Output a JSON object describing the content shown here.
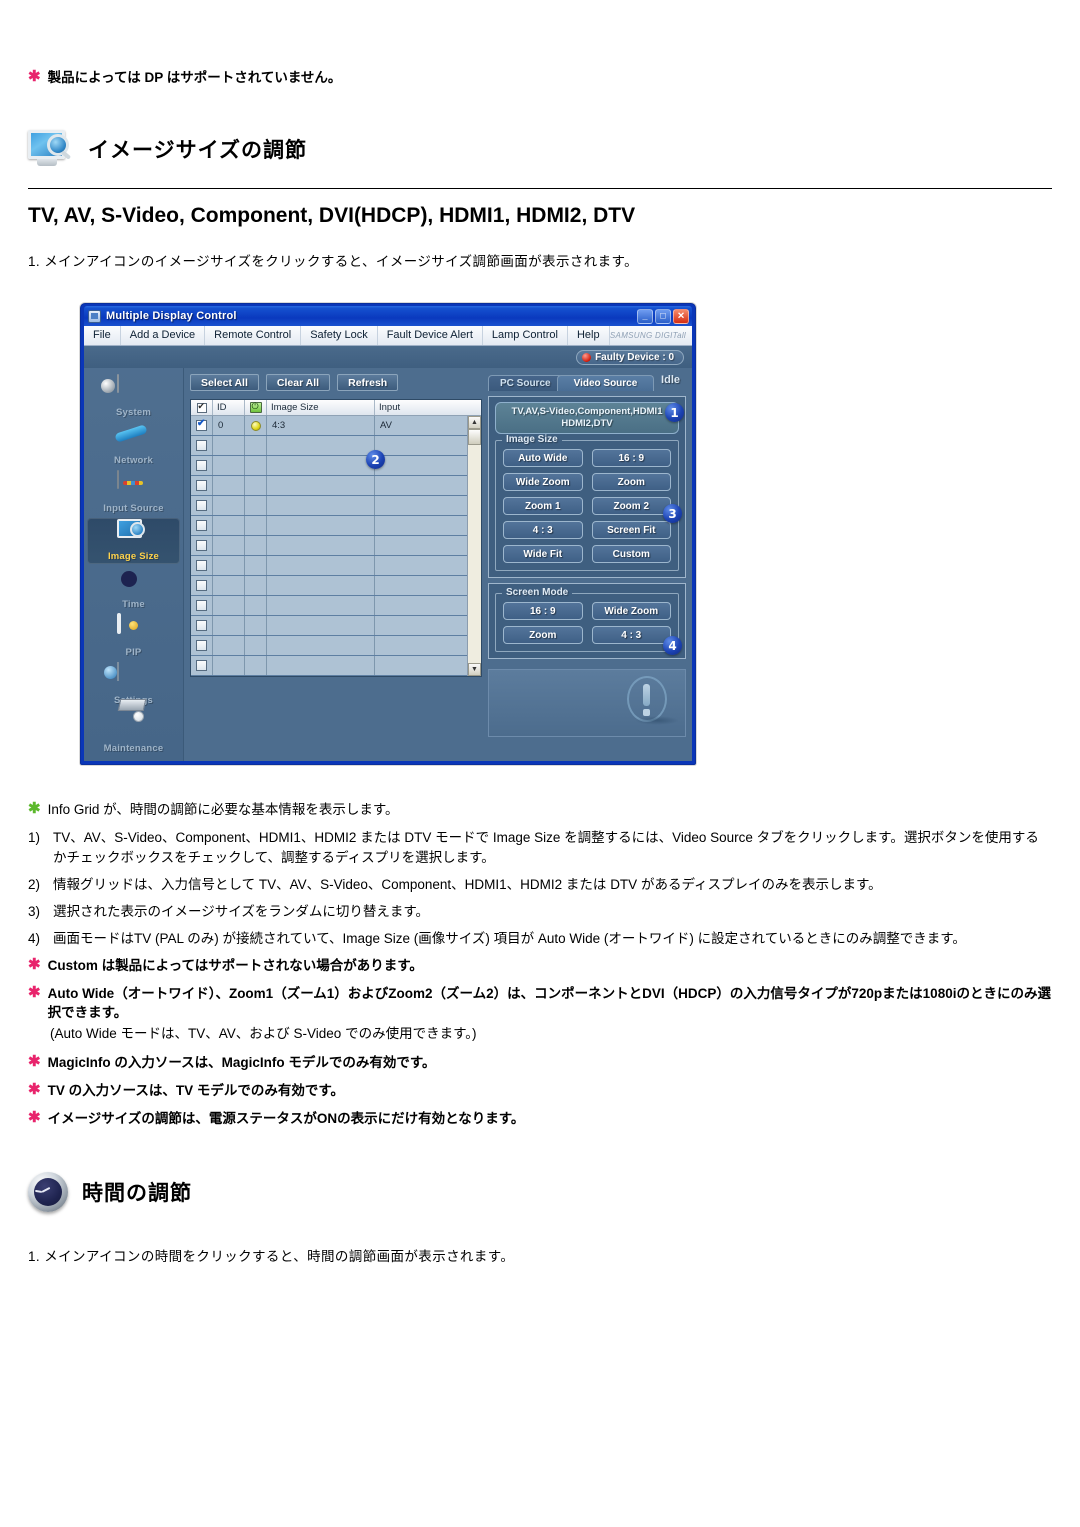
{
  "top_note": "製品によっては DP はサポートされていません。",
  "heading_image_size": "イメージサイズの調節",
  "subheading": "TV, AV, S-Video, Component, DVI(HDCP), HDMI1, HDMI2, DTV",
  "step1": "1. メインアイコンのイメージサイズをクリックすると、イメージサイズ調節画面が表示されます。",
  "app": {
    "title": "Multiple Display Control",
    "window_buttons": {
      "minimize": "_",
      "maximize": "□",
      "close": "✕"
    },
    "menu": [
      "File",
      "Add a Device",
      "Remote Control",
      "Safety Lock",
      "Fault Device Alert",
      "Lamp Control",
      "Help"
    ],
    "brand": "SAMSUNG DIGITall",
    "faulty_badge": "Faulty Device : 0",
    "status": "Idle",
    "sidebar": [
      {
        "label": "System",
        "icon": "system-icon",
        "active": false
      },
      {
        "label": "Network",
        "icon": "network-icon",
        "active": false
      },
      {
        "label": "Input Source",
        "icon": "input-source-icon",
        "active": false
      },
      {
        "label": "Image Size",
        "icon": "image-size-icon",
        "active": true
      },
      {
        "label": "Time",
        "icon": "time-icon",
        "active": false
      },
      {
        "label": "PIP",
        "icon": "pip-icon",
        "active": false
      },
      {
        "label": "Settings",
        "icon": "settings-icon",
        "active": false
      },
      {
        "label": "Maintenance",
        "icon": "maintenance-icon",
        "active": false
      }
    ],
    "toolbar": [
      "Select All",
      "Clear All",
      "Refresh"
    ],
    "grid": {
      "columns": [
        "",
        "ID",
        "",
        "Image Size",
        "Input"
      ],
      "rows": [
        {
          "checked": true,
          "id": "0",
          "power": "on",
          "image_size": "4:3",
          "input": "AV"
        },
        {
          "checked": false,
          "id": "",
          "power": "",
          "image_size": "",
          "input": ""
        },
        {
          "checked": false,
          "id": "",
          "power": "",
          "image_size": "",
          "input": ""
        },
        {
          "checked": false,
          "id": "",
          "power": "",
          "image_size": "",
          "input": ""
        },
        {
          "checked": false,
          "id": "",
          "power": "",
          "image_size": "",
          "input": ""
        },
        {
          "checked": false,
          "id": "",
          "power": "",
          "image_size": "",
          "input": ""
        },
        {
          "checked": false,
          "id": "",
          "power": "",
          "image_size": "",
          "input": ""
        },
        {
          "checked": false,
          "id": "",
          "power": "",
          "image_size": "",
          "input": ""
        },
        {
          "checked": false,
          "id": "",
          "power": "",
          "image_size": "",
          "input": ""
        },
        {
          "checked": false,
          "id": "",
          "power": "",
          "image_size": "",
          "input": ""
        },
        {
          "checked": false,
          "id": "",
          "power": "",
          "image_size": "",
          "input": ""
        },
        {
          "checked": false,
          "id": "",
          "power": "",
          "image_size": "",
          "input": ""
        },
        {
          "checked": false,
          "id": "",
          "power": "",
          "image_size": "",
          "input": ""
        }
      ]
    },
    "tabs": [
      {
        "label": "PC Source",
        "active": false
      },
      {
        "label": "Video Source",
        "active": true
      }
    ],
    "source_label": "TV,AV,S-Video,Component,HDMI1\nHDMI2,DTV",
    "image_size_group": {
      "label": "Image Size",
      "buttons": [
        "Auto Wide",
        "16 : 9",
        "Wide Zoom",
        "Zoom",
        "Zoom 1",
        "Zoom 2",
        "4 : 3",
        "Screen Fit",
        "Wide Fit",
        "Custom"
      ]
    },
    "screen_mode_group": {
      "label": "Screen Mode",
      "buttons": [
        "16 : 9",
        "Wide Zoom",
        "Zoom",
        "4 : 3"
      ]
    },
    "callouts": [
      "1",
      "2",
      "3",
      "4"
    ]
  },
  "notes": {
    "info_grid": "Info Grid が、時間の調節に必要な基本情報を表示します。",
    "numbered": [
      {
        "n": "1)",
        "t": "TV、AV、S-Video、Component、HDMI1、HDMI2 または DTV モードで Image Size を調整するには、Video Source タブをクリックします。選択ボタンを使用するかチェックボックスをチェックして、調整するディスプリを選択します。"
      },
      {
        "n": "2)",
        "t": "情報グリッドは、入力信号として TV、AV、S-Video、Component、HDMI1、HDMI2 または DTV があるディスプレイのみを表示します。"
      },
      {
        "n": "3)",
        "t": "選択された表示のイメージサイズをランダムに切り替えます。"
      },
      {
        "n": "4)",
        "t": "画面モードはTV (PAL のみ) が接続されていて、Image Size (画像サイズ) 項目が Auto Wide (オートワイド) に設定されているときにのみ調整できます。"
      }
    ],
    "asterisks": [
      "Custom は製品によってはサポートされない場合があります。",
      "Auto Wide（オートワイド）、Zoom1（ズーム1）およびZoom2（ズーム2）は、コンポーネントとDVI（HDCP）の入力信号タイプが720pまたは1080iのときにのみ選択できます。",
      "MagicInfo の入力ソースは、MagicInfo モデルでのみ有効です。",
      "TV の入力ソースは、TV モデルでのみ有効です。",
      "イメージサイズの調節は、電源ステータスがONの表示にだけ有効となります。"
    ],
    "auto_wide_paren": "(Auto Wide モードは、TV、AV、および S-Video でのみ使用できます。)"
  },
  "heading_time": "時間の調節",
  "step_time": "1. メインアイコンの時間をクリックすると、時間の調節画面が表示されます。"
}
